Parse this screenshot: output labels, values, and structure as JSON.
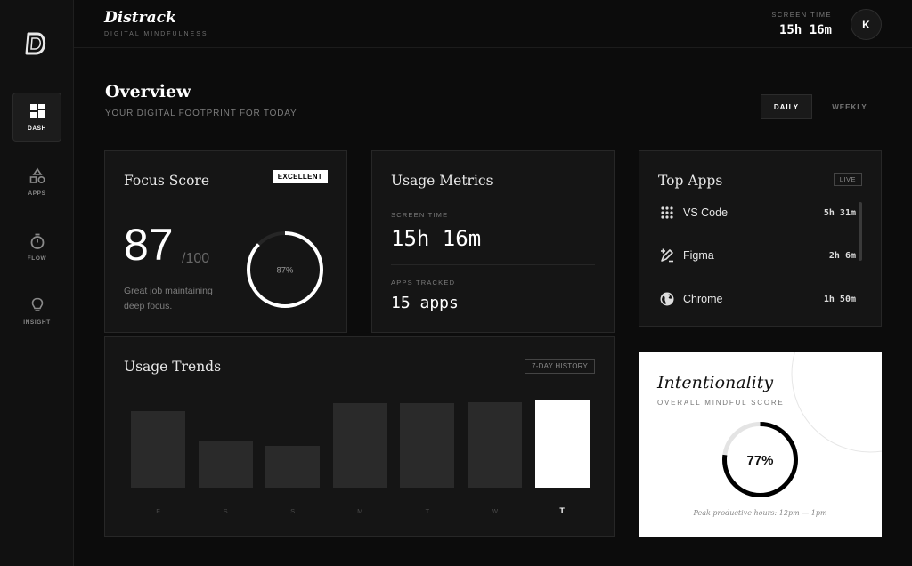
{
  "brand": {
    "name": "Distrack",
    "tagline": "DIGITAL MINDFULNESS"
  },
  "header": {
    "screen_time_label": "SCREEN TIME",
    "screen_time_value": "15h 16m",
    "avatar_initial": "K"
  },
  "sidebar": {
    "items": [
      {
        "label": "DASH",
        "icon": "dashboard-icon",
        "active": true
      },
      {
        "label": "APPS",
        "icon": "apps-shapes-icon",
        "active": false
      },
      {
        "label": "FLOW",
        "icon": "stopwatch-icon",
        "active": false
      },
      {
        "label": "INSIGHT",
        "icon": "lightbulb-icon",
        "active": false
      }
    ]
  },
  "page": {
    "title": "Overview",
    "subtitle": "YOUR DIGITAL FOOTPRINT FOR TODAY"
  },
  "range_toggle": {
    "daily": "DAILY",
    "weekly": "WEEKLY",
    "selected": "daily"
  },
  "focus": {
    "title": "Focus Score",
    "badge": "EXCELLENT",
    "score": "87",
    "out_of": "/100",
    "percent_label": "87%",
    "percent": 87,
    "message": "Great job maintaining deep focus."
  },
  "metrics": {
    "title": "Usage Metrics",
    "screen_time_label": "SCREEN TIME",
    "screen_time_value": "15h 16m",
    "apps_tracked_label": "APPS TRACKED",
    "apps_tracked_value": "15 apps"
  },
  "top_apps": {
    "title": "Top Apps",
    "badge": "LIVE",
    "apps": [
      {
        "name": "VS Code",
        "time": "5h 31m",
        "icon": "grid-dots-icon"
      },
      {
        "name": "Figma",
        "time": "2h 6m",
        "icon": "pen-tool-icon"
      },
      {
        "name": "Chrome",
        "time": "1h 50m",
        "icon": "globe-icon"
      }
    ]
  },
  "trends": {
    "title": "Usage Trends",
    "badge": "7-DAY HISTORY",
    "days": [
      "F",
      "S",
      "S",
      "M",
      "T",
      "W",
      "T"
    ],
    "values": [
      0.66,
      0.41,
      0.36,
      0.73,
      0.73,
      0.74,
      0.76
    ],
    "today_index": 6
  },
  "intentionality": {
    "title": "Intentionality",
    "subtitle": "OVERALL MINDFUL SCORE",
    "percent_label": "77%",
    "percent": 77,
    "footer": "Peak productive hours: 12pm — 1pm"
  }
}
